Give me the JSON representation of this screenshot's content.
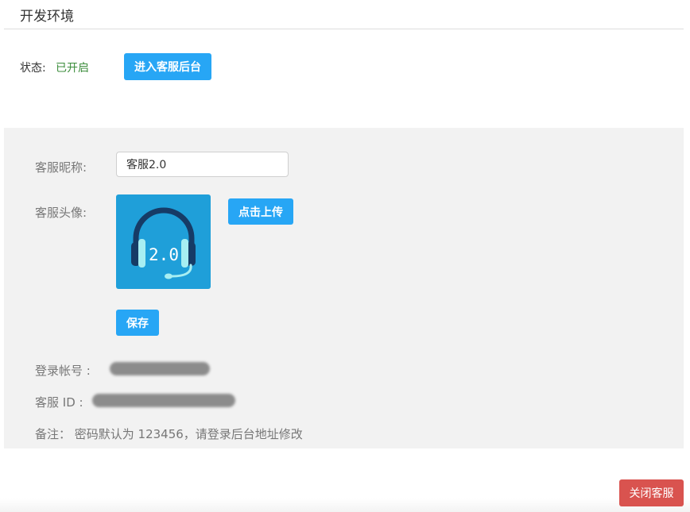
{
  "header": {
    "title": "开发环境"
  },
  "status": {
    "label": "状态:",
    "value": "已开启",
    "enter_button": "进入客服后台"
  },
  "form": {
    "nickname_label": "客服昵称:",
    "nickname_value": "客服2.0",
    "avatar_label": "客服头像:",
    "avatar_icon": "headset-icon",
    "avatar_text": "2.0",
    "upload_button": "点击上传",
    "save_button": "保存"
  },
  "info": {
    "account_label": "登录帐号 :",
    "csid_label": "客服 ID :",
    "note": "备注： 密码默认为 123456，请登录后台地址修改"
  },
  "footer": {
    "close_button": "关闭客服"
  },
  "colors": {
    "primary": "#27a6f5",
    "danger": "#d9534f",
    "status_green": "#3c8d3c",
    "panel_bg": "#f2f2f2",
    "avatar_bg": "#1f9fd9"
  }
}
